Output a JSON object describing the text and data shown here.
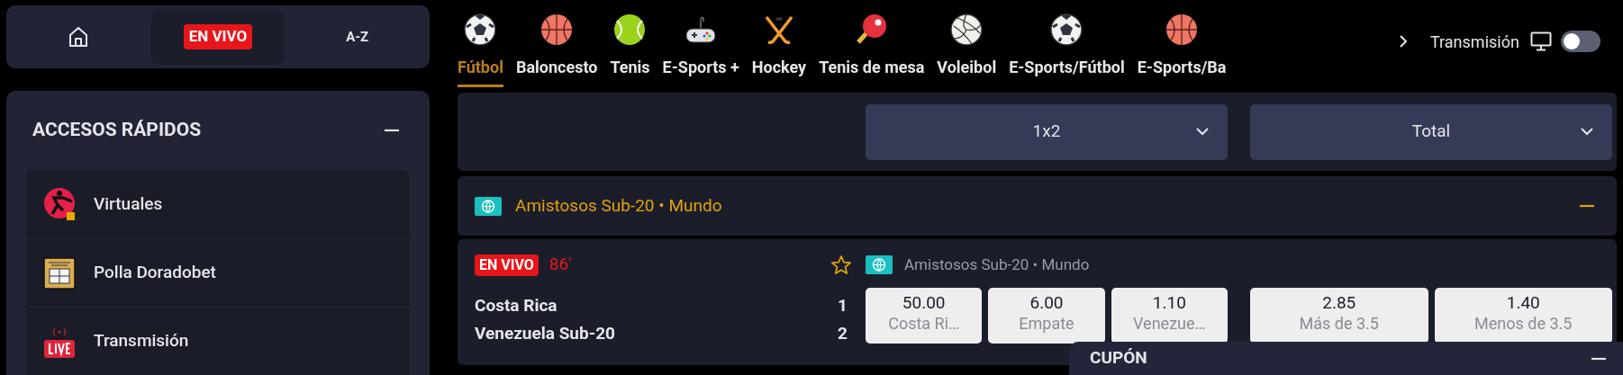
{
  "top_nav": [
    {
      "kind": "home",
      "selected": false
    },
    {
      "kind": "live",
      "label": "EN VIVO",
      "selected": true
    },
    {
      "kind": "text",
      "label": "A-Z",
      "selected": false
    }
  ],
  "quick_access": {
    "title": "ACCESOS RÁPIDOS",
    "expanded": true,
    "items": [
      {
        "kind": "virtual",
        "label": "Virtuales"
      },
      {
        "kind": "pool",
        "label": "Polla Doradobet"
      },
      {
        "kind": "live",
        "label": "Transmisión"
      }
    ]
  },
  "sports_tabs": [
    {
      "kind": "soccer",
      "label": "Fútbol",
      "selected": true
    },
    {
      "kind": "basketball",
      "label": "Baloncesto",
      "selected": false
    },
    {
      "kind": "tennis",
      "label": "Tenis",
      "selected": false
    },
    {
      "kind": "gamepad",
      "label": "E-Sports +",
      "selected": false
    },
    {
      "kind": "hockey",
      "label": "Hockey",
      "selected": false
    },
    {
      "kind": "pingpong",
      "label": "Tenis de mesa",
      "selected": false
    },
    {
      "kind": "volleyball",
      "label": "Voleibol",
      "selected": false
    },
    {
      "kind": "soccer",
      "label": "E-Sports/Fútbol",
      "selected": false
    },
    {
      "kind": "basketball",
      "label": "E-Sports/Ba",
      "selected": false
    }
  ],
  "streaming": {
    "label": "Transmisión",
    "on": false
  },
  "market_selectors": [
    {
      "label": "1x2"
    },
    {
      "label": "Total"
    }
  ],
  "league": {
    "title": "Amistosos Sub-20 • Mundo",
    "expanded": true
  },
  "match": {
    "live_badge": "EN VIVO",
    "minute": "86'",
    "favorite": false,
    "league": "Amistosos Sub-20 • Mundo",
    "teams": [
      {
        "name": "Costa Rica",
        "score": "1"
      },
      {
        "name": "Venezuela Sub-20",
        "score": "2"
      }
    ],
    "odds": [
      [
        {
          "price": "50.00",
          "label": "Costa Ri…"
        },
        {
          "price": "6.00",
          "label": "Empate"
        },
        {
          "price": "1.10",
          "label": "Venezue…"
        }
      ],
      [
        {
          "price": "2.85",
          "label": "Más de 3.5"
        },
        {
          "price": "1.40",
          "label": "Menos de 3.5"
        }
      ]
    ]
  },
  "coupon": {
    "title": "CUPÓN",
    "expanded": true
  }
}
